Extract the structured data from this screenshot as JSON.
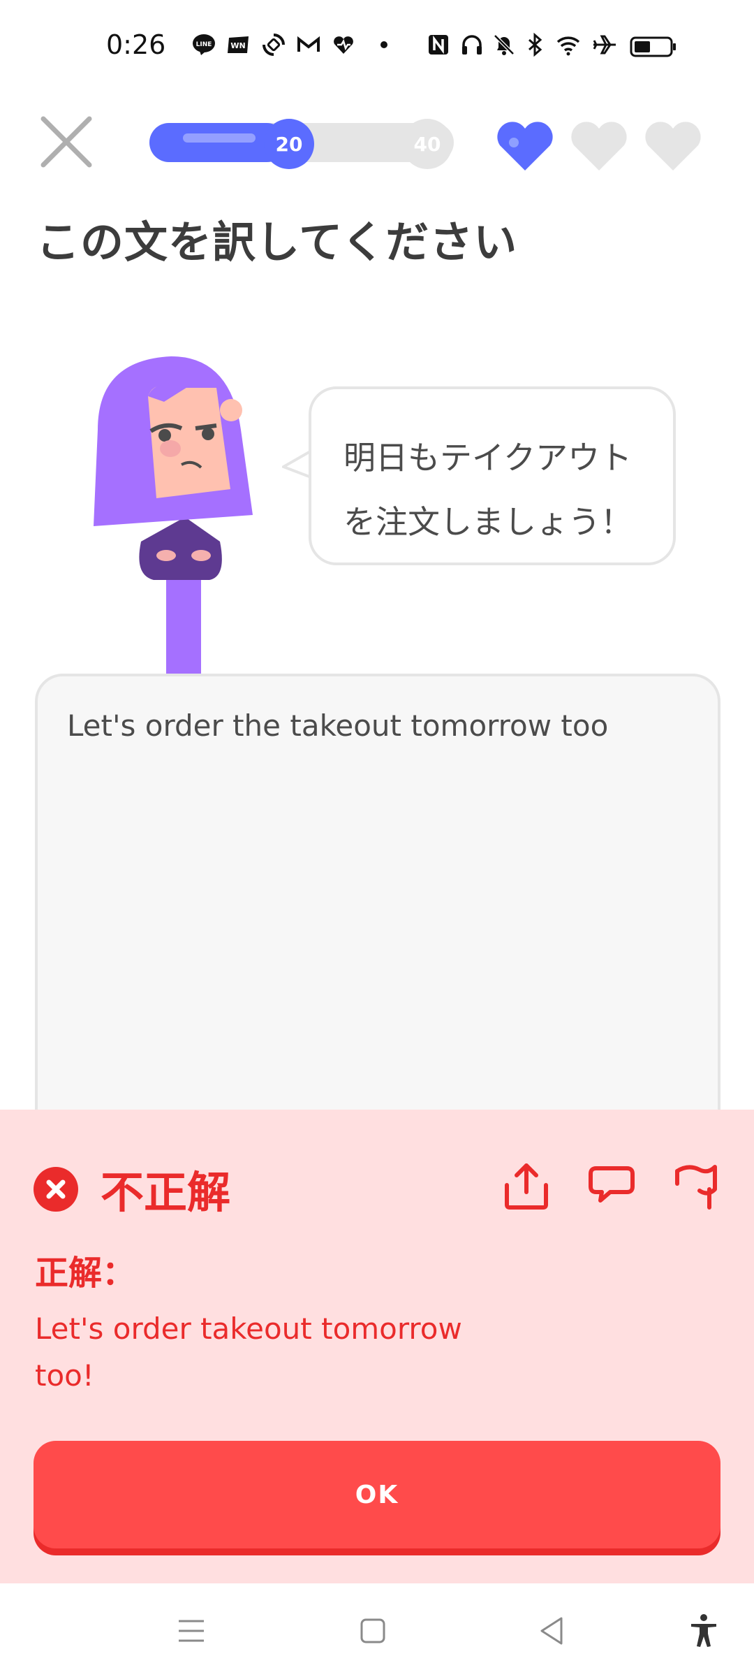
{
  "status_bar": {
    "time": "0:26",
    "icons": [
      "line-icon",
      "news-icon",
      "sync-icon",
      "gmail-icon",
      "heart-app-icon",
      "dot-icon",
      "nfc-icon",
      "headphones-icon",
      "mute-icon",
      "bluetooth-icon",
      "wifi-icon",
      "airplane-icon",
      "battery-icon"
    ]
  },
  "header": {
    "progress": 0.45,
    "milestones": [
      "20",
      "40"
    ],
    "hearts_total": 3,
    "hearts_remaining": 1
  },
  "exercise": {
    "title": "この文を訳してください",
    "prompt_line1": "明日もテイクアウト",
    "prompt_line2": "を注文しましょう！",
    "user_answer": "Let's order the takeout tomorrow too"
  },
  "feedback": {
    "status": "不正解",
    "correct_label": "正解：",
    "correct_answer": "Let's order takeout tomorrow too!",
    "ok_label": "OK"
  },
  "colors": {
    "accent": "#5b6cff",
    "error": "#ea2b2b",
    "error_bg": "#ffdfe0",
    "button": "#ff4b4b"
  }
}
